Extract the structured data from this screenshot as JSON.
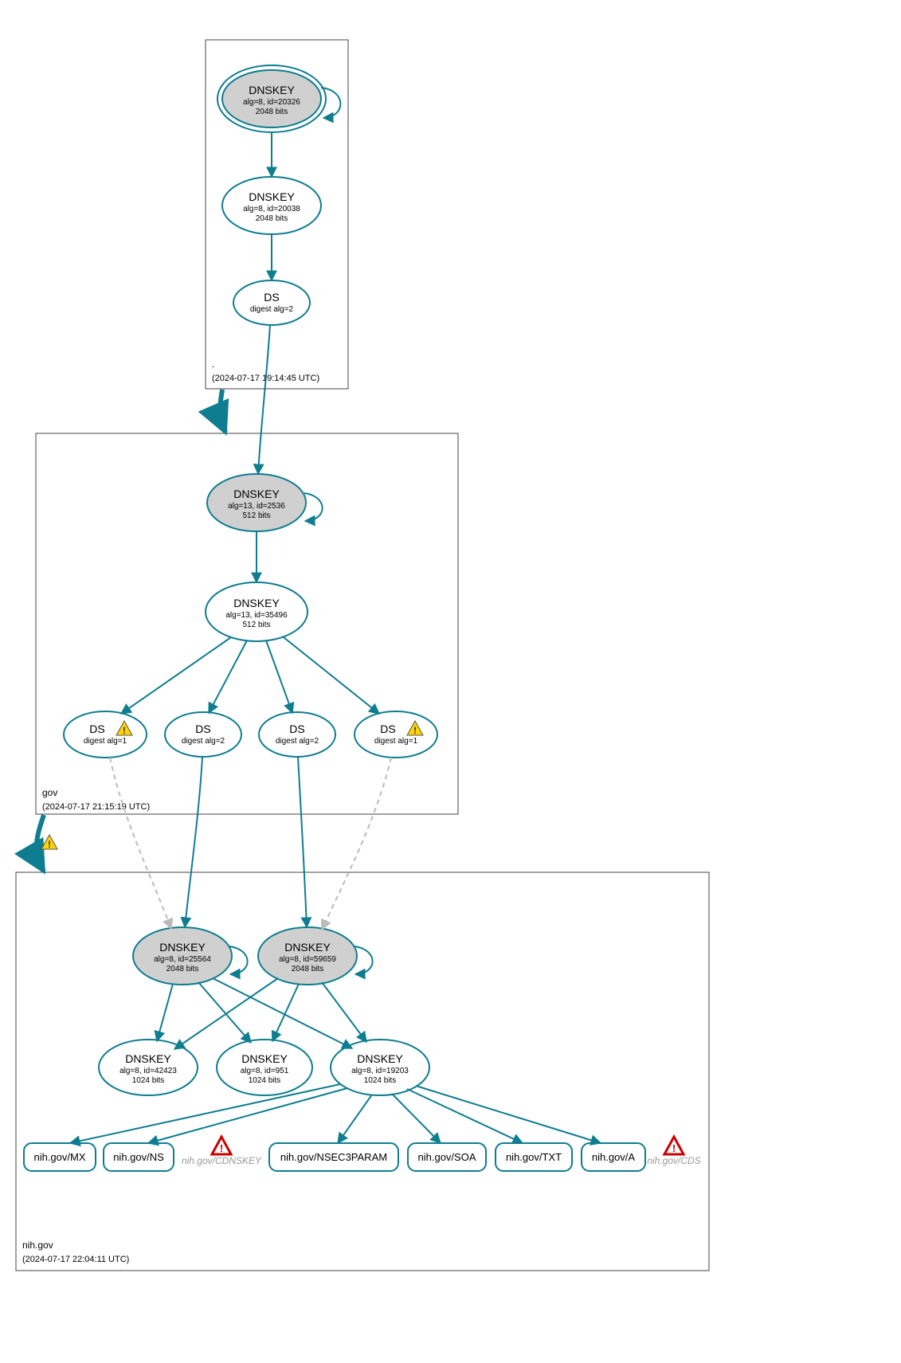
{
  "colors": {
    "accent": "#0f7d90",
    "grey_fill": "#d0d0d0"
  },
  "zones": {
    "root": {
      "name": ".",
      "timestamp": "(2024-07-17 19:14:45 UTC)"
    },
    "gov": {
      "name": "gov",
      "timestamp": "(2024-07-17 21:15:19 UTC)"
    },
    "nih": {
      "name": "nih.gov",
      "timestamp": "(2024-07-17 22:04:11 UTC)"
    }
  },
  "nodes": {
    "root_ksk": {
      "title": "DNSKEY",
      "l2": "alg=8, id=20326",
      "l3": "2048 bits"
    },
    "root_zsk": {
      "title": "DNSKEY",
      "l2": "alg=8, id=20038",
      "l3": "2048 bits"
    },
    "root_ds": {
      "title": "DS",
      "l2": "digest alg=2"
    },
    "gov_ksk": {
      "title": "DNSKEY",
      "l2": "alg=13, id=2536",
      "l3": "512 bits"
    },
    "gov_zsk": {
      "title": "DNSKEY",
      "l2": "alg=13, id=35496",
      "l3": "512 bits"
    },
    "gov_ds1": {
      "title": "DS",
      "l2": "digest alg=1"
    },
    "gov_ds2": {
      "title": "DS",
      "l2": "digest alg=2"
    },
    "gov_ds3": {
      "title": "DS",
      "l2": "digest alg=2"
    },
    "gov_ds4": {
      "title": "DS",
      "l2": "digest alg=1"
    },
    "nih_ksk1": {
      "title": "DNSKEY",
      "l2": "alg=8, id=25564",
      "l3": "2048 bits"
    },
    "nih_ksk2": {
      "title": "DNSKEY",
      "l2": "alg=8, id=59659",
      "l3": "2048 bits"
    },
    "nih_zsk1": {
      "title": "DNSKEY",
      "l2": "alg=8, id=42423",
      "l3": "1024 bits"
    },
    "nih_zsk2": {
      "title": "DNSKEY",
      "l2": "alg=8, id=951",
      "l3": "1024 bits"
    },
    "nih_zsk3": {
      "title": "DNSKEY",
      "l2": "alg=8, id=19203",
      "l3": "1024 bits"
    }
  },
  "records": {
    "mx": "nih.gov/MX",
    "ns": "nih.gov/NS",
    "cdnskey": "nih.gov/CDNSKEY",
    "nsec3param": "nih.gov/NSEC3PARAM",
    "soa": "nih.gov/SOA",
    "txt": "nih.gov/TXT",
    "a": "nih.gov/A",
    "cds": "nih.gov/CDS"
  }
}
